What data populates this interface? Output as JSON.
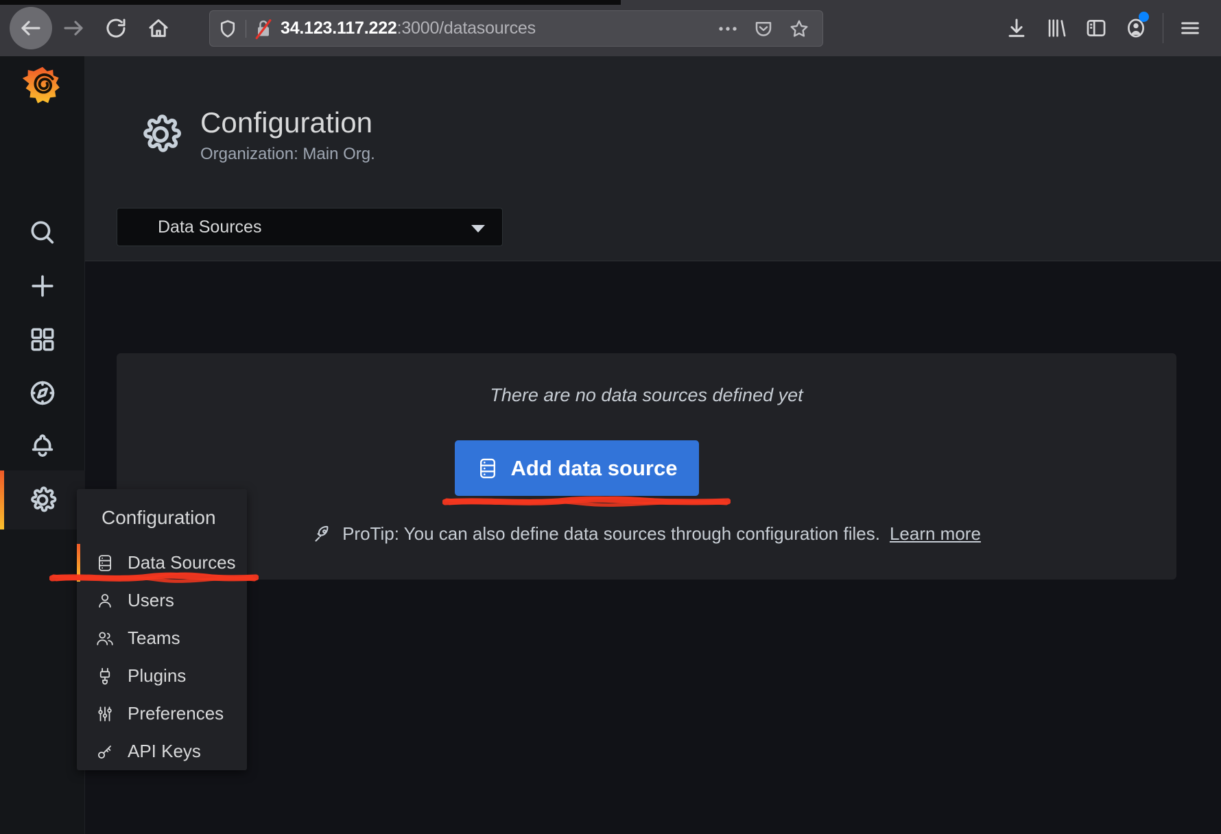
{
  "browser": {
    "back_label": "Back",
    "forward_label": "Forward",
    "reload_label": "Reload",
    "home_label": "Home",
    "url_host": "34.123.117.222",
    "url_rest": ":3000/datasources",
    "shield_icon": "shield-icon",
    "insecure_lock_icon": "insecure-lock-icon",
    "page_actions_icon": "ellipsis-icon",
    "pocket_icon": "pocket-icon",
    "bookmark_icon": "star-icon",
    "downloads_icon": "download-icon",
    "library_icon": "library-icon",
    "sidebar_icon": "sidebar-icon",
    "account_icon": "account-icon",
    "menu_icon": "hamburger-menu-icon"
  },
  "rail": {
    "logo_label": "Grafana",
    "items": [
      {
        "label": "Search",
        "icon": "search-icon"
      },
      {
        "label": "Create",
        "icon": "plus-icon"
      },
      {
        "label": "Dashboards",
        "icon": "dashboards-grid-icon"
      },
      {
        "label": "Explore",
        "icon": "compass-icon"
      },
      {
        "label": "Alerting",
        "icon": "bell-icon"
      },
      {
        "label": "Configuration",
        "icon": "gear-icon"
      }
    ]
  },
  "header": {
    "icon": "gear-icon",
    "title": "Configuration",
    "subtitle": "Organization: Main Org.",
    "selector_value": "Data Sources",
    "selector_caret": "chevron-down-icon"
  },
  "main": {
    "empty_message": "There are no data sources defined yet",
    "add_button_label": "Add data source",
    "add_button_icon": "database-icon",
    "add_button_color": "#3274d9",
    "protip_icon": "rocket-icon",
    "protip_text": "ProTip: You can also define data sources through configuration files.",
    "protip_link": "Learn more"
  },
  "flyout": {
    "heading": "Configuration",
    "items": [
      {
        "label": "Data Sources",
        "icon": "database-icon",
        "active": true
      },
      {
        "label": "Users",
        "icon": "user-icon",
        "active": false
      },
      {
        "label": "Teams",
        "icon": "users-group-icon",
        "active": false
      },
      {
        "label": "Plugins",
        "icon": "plug-icon",
        "active": false
      },
      {
        "label": "Preferences",
        "icon": "sliders-icon",
        "active": false
      },
      {
        "label": "API Keys",
        "icon": "key-icon",
        "active": false
      }
    ]
  },
  "annotations": {
    "color": "#f4371f",
    "marks": [
      {
        "name": "underline-add-data-source-button"
      },
      {
        "name": "underline-data-sources-menu-item"
      }
    ]
  }
}
